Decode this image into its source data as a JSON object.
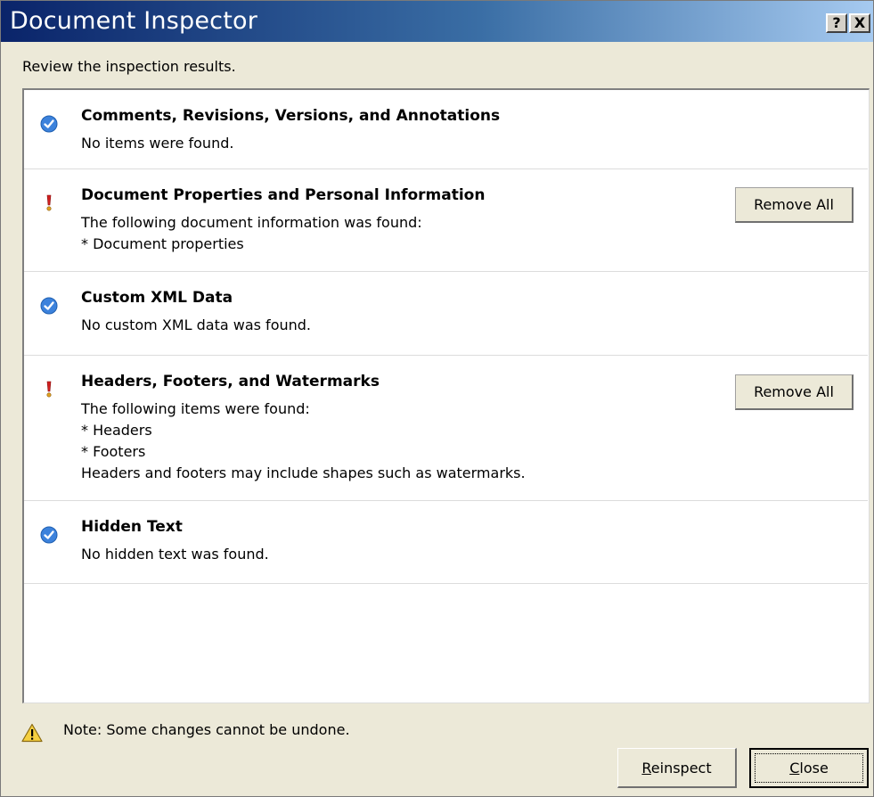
{
  "window": {
    "title": "Document Inspector",
    "help_label": "?",
    "close_label": "X",
    "subtitle": "Review the inspection results."
  },
  "results": [
    {
      "status": "ok",
      "title": "Comments, Revisions, Versions, and Annotations",
      "lines": [
        "No items were found."
      ]
    },
    {
      "status": "warning",
      "title": "Document Properties and Personal Information",
      "lines": [
        "The following document information was found:",
        "* Document properties"
      ],
      "button": "Remove All"
    },
    {
      "status": "ok",
      "title": "Custom XML Data",
      "lines": [
        "No custom XML data was found."
      ]
    },
    {
      "status": "warning",
      "title": "Headers, Footers, and Watermarks",
      "lines": [
        "The following items were found:",
        "* Headers",
        "* Footers",
        "Headers and footers may include shapes such as watermarks."
      ],
      "button": "Remove All"
    },
    {
      "status": "ok",
      "title": "Hidden Text",
      "lines": [
        "No hidden text was found."
      ]
    }
  ],
  "footer": {
    "note": "Note: Some changes cannot be undone.",
    "reinspect_label": "Reinspect",
    "reinspect_access_key": "R",
    "close_label": "Close",
    "close_access_key": "C"
  },
  "icons": {
    "ok": "check-circle-icon",
    "warning": "exclamation-icon",
    "note": "warning-triangle-icon"
  },
  "colors": {
    "title_bar_start": "#0a246a",
    "title_bar_end": "#a6caf0",
    "ok_icon": "#3c82dc",
    "warning_icon": "#d02020"
  }
}
